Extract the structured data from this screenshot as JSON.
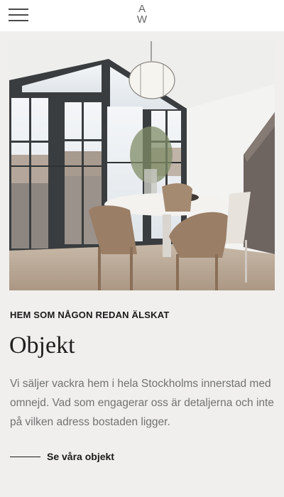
{
  "header": {
    "menu_icon": "hamburger-menu-icon",
    "logo_top": "A",
    "logo_bottom": "W"
  },
  "hero": {
    "image_subject": "dining room with round white table, brown chairs, pendant lamp and glass balcony doors"
  },
  "section": {
    "eyebrow": "HEM SOM NÅGON REDAN ÄLSKAT",
    "title": "Objekt",
    "body": "Vi säljer vackra hem i hela Stockholms innerstad med omnejd. Vad som engagerar oss är detaljerna och inte på vilken adress bostaden ligger.",
    "cta_label": "Se våra objekt"
  },
  "colors": {
    "page_background": "#f0efed",
    "header_background": "#ffffff",
    "text_dark": "#1a1a1a",
    "text_muted": "#727272",
    "window_frame": "#3a3d3f",
    "chair_brown": "#9a7e66"
  }
}
